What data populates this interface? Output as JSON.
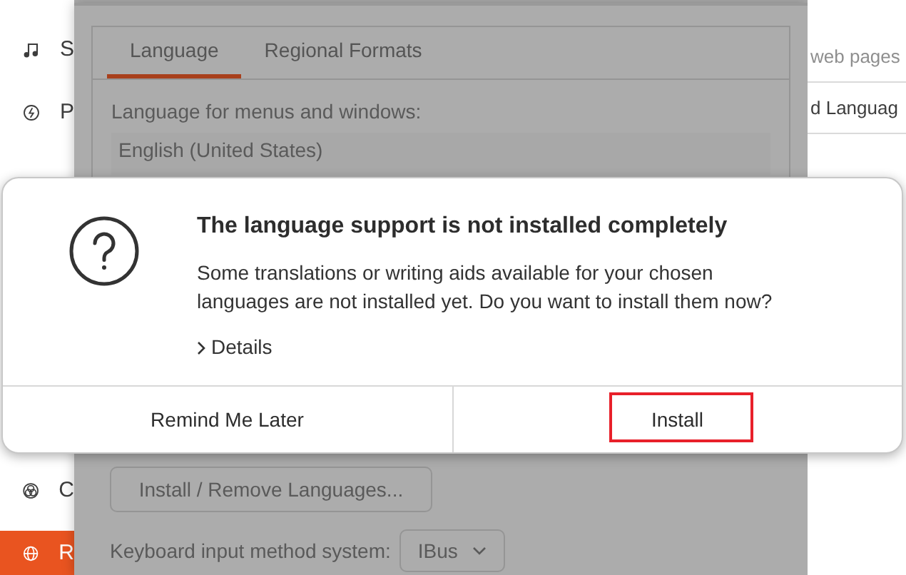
{
  "sidebar": {
    "items": [
      {
        "label": "S",
        "selected": false
      },
      {
        "label": "P",
        "selected": false
      },
      {
        "label": "C",
        "selected": false
      },
      {
        "label": "R",
        "selected": true
      }
    ]
  },
  "language_dialog": {
    "tabs": [
      {
        "label": "Language",
        "selected": true
      },
      {
        "label": "Regional Formats",
        "selected": false
      }
    ],
    "list_label": "Language for menus and windows:",
    "languages": [
      "English (United States)"
    ],
    "install_remove_button": "Install / Remove Languages...",
    "input_method_label": "Keyboard input method system:",
    "input_method_value": "IBus"
  },
  "settings_panel": {
    "rows": [
      {
        "text": "web pages",
        "kind": "hint"
      },
      {
        "text": "d Languag",
        "kind": "item"
      }
    ]
  },
  "alert": {
    "title": "The language support is not installed completely",
    "message": "Some translations or writing aids available for your chosen languages are not installed yet. Do you want to install them now?",
    "details": "Details",
    "buttons": [
      {
        "label": "Remind Me Later",
        "highlighted": false
      },
      {
        "label": "Install",
        "highlighted": true
      }
    ]
  }
}
